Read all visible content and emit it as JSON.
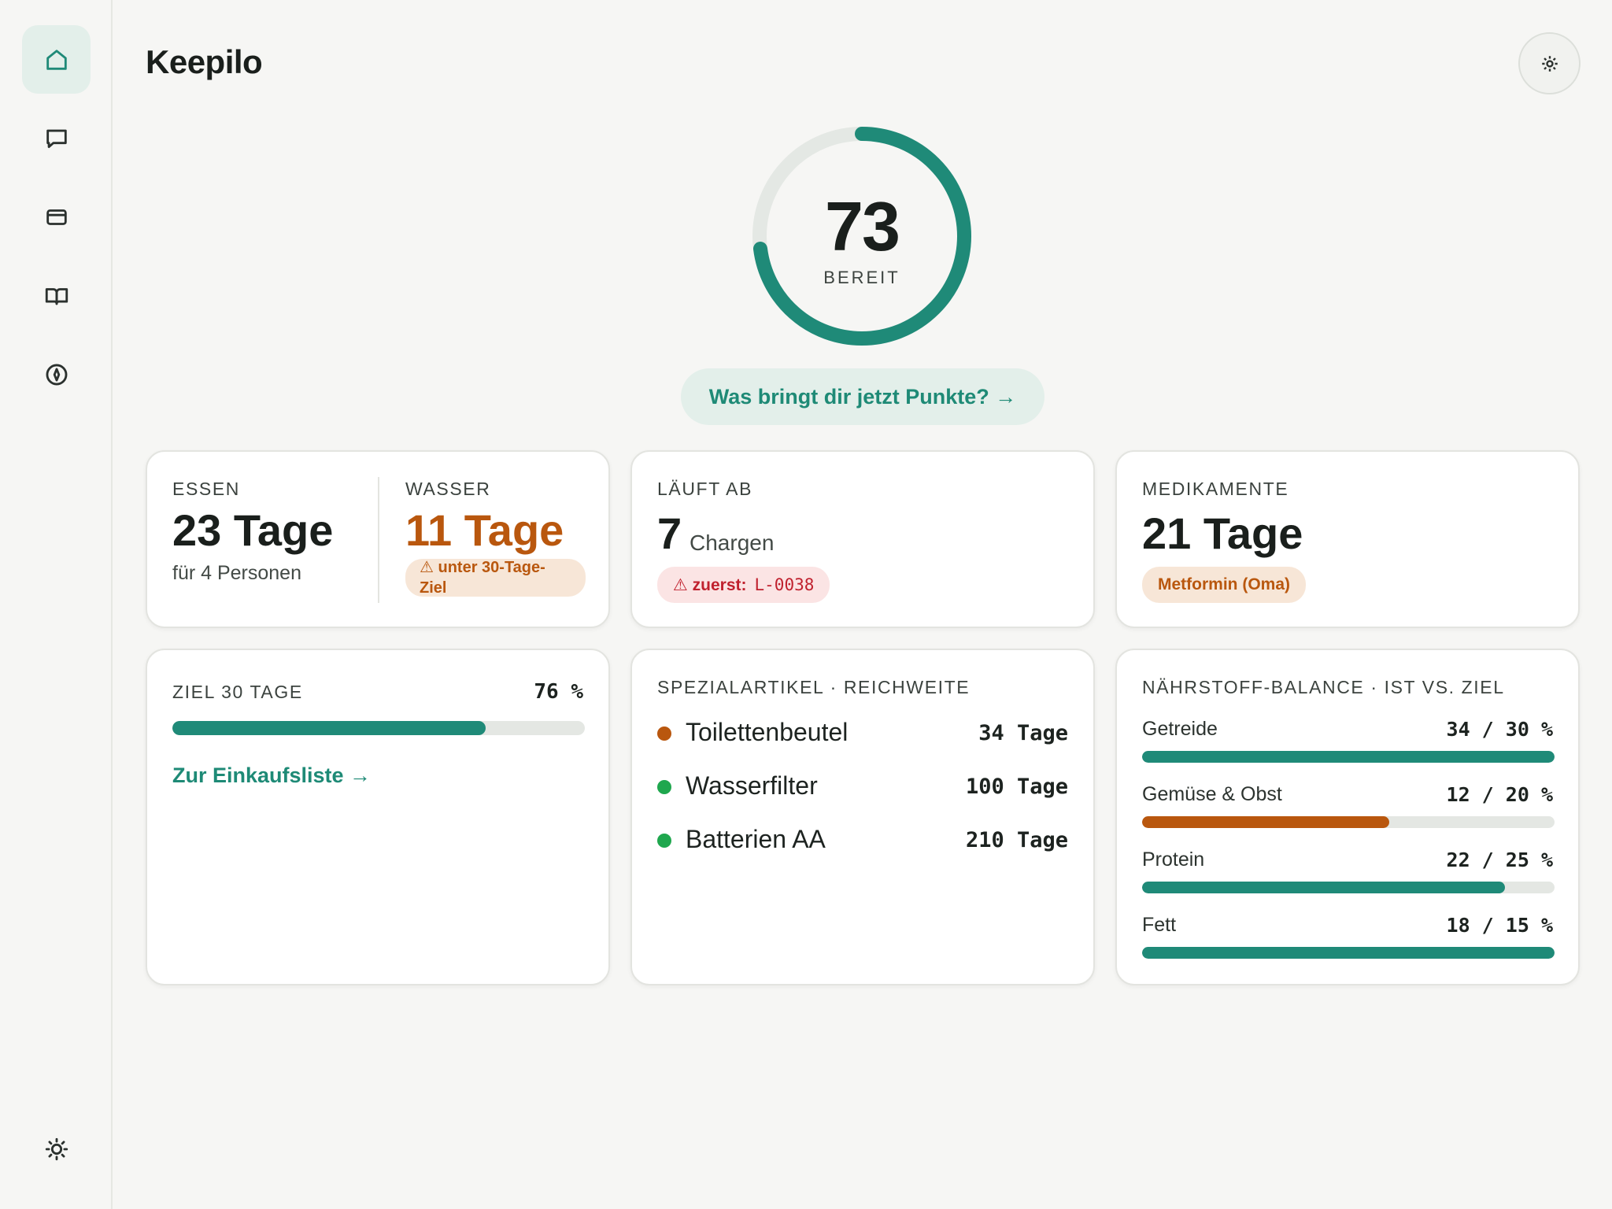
{
  "app": {
    "title": "Keepilo",
    "accent": "#1f8a78",
    "warning": "#b9570e",
    "danger": "#c0212e"
  },
  "sidebar": {
    "items": [
      {
        "icon": "home-icon",
        "active": true
      },
      {
        "icon": "chat-icon",
        "active": false
      },
      {
        "icon": "card-icon",
        "active": false
      },
      {
        "icon": "book-icon",
        "active": false
      },
      {
        "icon": "compass-icon",
        "active": false
      }
    ],
    "bottom_icon": "sun-icon"
  },
  "header": {
    "settings_icon": "gear-icon"
  },
  "score": {
    "value": "73",
    "label": "BEREIT",
    "fraction": 0.73
  },
  "points_button": {
    "label": "Was bringt dir jetzt Punkte? →"
  },
  "cards": {
    "food_water": {
      "food_label": "ESSEN",
      "food_value": "23 Tage",
      "food_sub": "für 4 Personen",
      "water_label": "WASSER",
      "water_value": "11 Tage",
      "water_warning": "⚠ unter 30-Tage-Ziel"
    },
    "expiring": {
      "label": "LÄUFT AB",
      "value": "7",
      "unit": "Chargen",
      "warning_prefix": "⚠ zuerst:",
      "warning_code": "L-0038"
    },
    "medication": {
      "label": "MEDIKAMENTE",
      "value": "21 Tage",
      "note": "Metformin (Oma)"
    },
    "goal": {
      "label": "ZIEL 30 TAGE",
      "percent_text": "76 %",
      "progress": 0.76,
      "link": "Zur Einkaufsliste →"
    },
    "special": {
      "label": "SPEZIALARTIKEL · REICHWEITE",
      "items": [
        {
          "name": "Toilettenbeutel",
          "value": "34 Tage",
          "status_color": "#b9570e"
        },
        {
          "name": "Wasserfilter",
          "value": "100 Tage",
          "status_color": "#1fa74e"
        },
        {
          "name": "Batterien AA",
          "value": "210 Tage",
          "status_color": "#1fa74e"
        }
      ]
    },
    "nutrients": {
      "label": "NÄHRSTOFF-BALANCE · IST VS. ZIEL",
      "items": [
        {
          "name": "Getreide",
          "value": "34 / 30 %",
          "progress": 1.0,
          "warn": false
        },
        {
          "name": "Gemüse & Obst",
          "value": "12 / 20 %",
          "progress": 0.6,
          "warn": true
        },
        {
          "name": "Protein",
          "value": "22 / 25 %",
          "progress": 0.88,
          "warn": false
        },
        {
          "name": "Fett",
          "value": "18 / 15 %",
          "progress": 1.0,
          "warn": false
        }
      ]
    }
  }
}
